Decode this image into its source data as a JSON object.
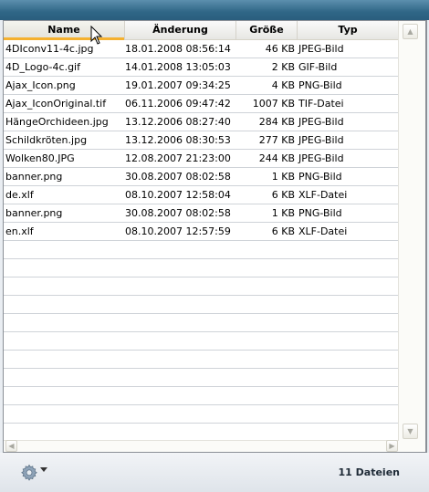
{
  "columns": {
    "name": "Name",
    "date": "Änderung",
    "size": "Größe",
    "type": "Typ"
  },
  "files": [
    {
      "name": "4DIconv11-4c.jpg",
      "date": "18.01.2008 08:56:14",
      "size": "46 KB",
      "type": "JPEG-Bild"
    },
    {
      "name": "4D_Logo-4c.gif",
      "date": "14.01.2008 13:05:03",
      "size": "2 KB",
      "type": "GIF-Bild"
    },
    {
      "name": "Ajax_Icon.png",
      "date": "19.01.2007 09:34:25",
      "size": "4 KB",
      "type": "PNG-Bild"
    },
    {
      "name": "Ajax_IconOriginal.tif",
      "date": "06.11.2006 09:47:42",
      "size": "1007 KB",
      "type": "TIF-Datei"
    },
    {
      "name": "HängeOrchideen.jpg",
      "date": "13.12.2006 08:27:40",
      "size": "284 KB",
      "type": "JPEG-Bild"
    },
    {
      "name": "Schildkröten.jpg",
      "date": "13.12.2006 08:30:53",
      "size": "277 KB",
      "type": "JPEG-Bild"
    },
    {
      "name": "Wolken80.JPG",
      "date": "12.08.2007 21:23:00",
      "size": "244 KB",
      "type": "JPEG-Bild"
    },
    {
      "name": "banner.png",
      "date": "30.08.2007 08:02:58",
      "size": "1 KB",
      "type": "PNG-Bild"
    },
    {
      "name": "de.xlf",
      "date": "08.10.2007 12:58:04",
      "size": "6 KB",
      "type": "XLF-Datei"
    },
    {
      "name": "banner.png",
      "date": "30.08.2007 08:02:58",
      "size": "1 KB",
      "type": "PNG-Bild"
    },
    {
      "name": "en.xlf",
      "date": "08.10.2007 12:57:59",
      "size": "6 KB",
      "type": "XLF-Datei"
    }
  ],
  "status": {
    "file_count": "11 Dateien",
    "menu_icon": "gear-icon"
  },
  "colors": {
    "sort_indicator": "#f5b12f",
    "titlebar": "#2f6686"
  }
}
